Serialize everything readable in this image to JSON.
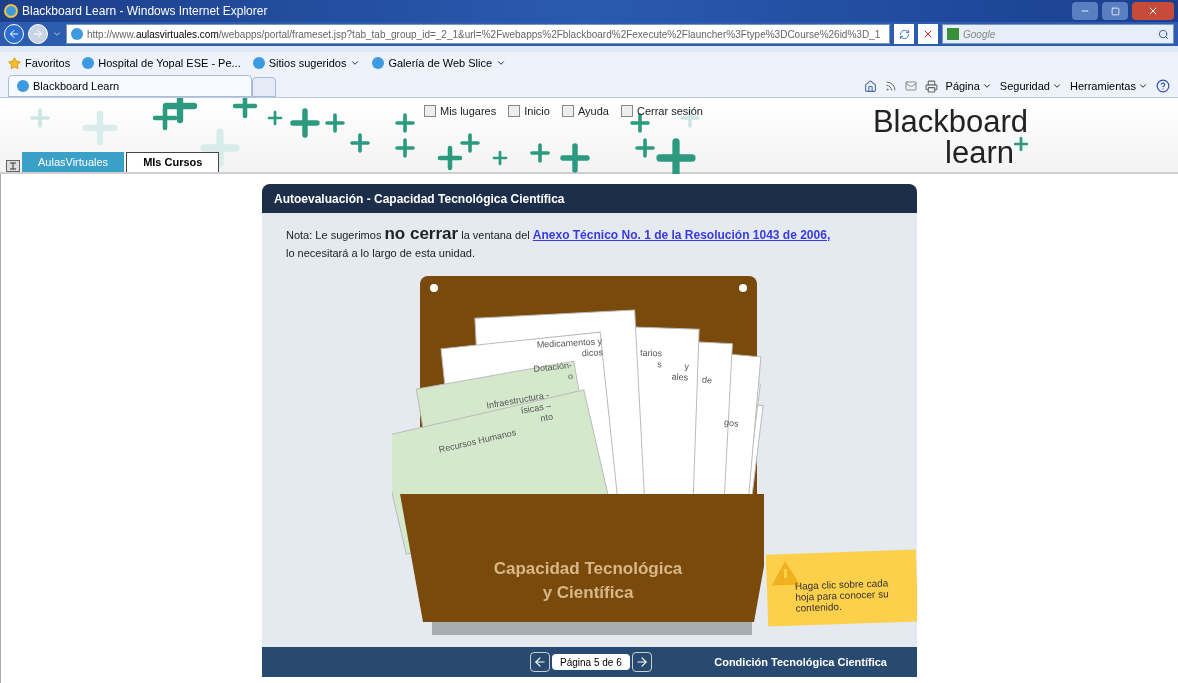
{
  "window": {
    "title": "Blackboard Learn - Windows Internet Explorer"
  },
  "address_bar": {
    "prefix": "http://www.",
    "domain": "aulasvirtuales.com",
    "path": "/webapps/portal/frameset.jsp?tab_tab_group_id=_2_1&url=%2Fwebapps%2Fblackboard%2Fexecute%2Flauncher%3Ftype%3DCourse%26id%3D_1"
  },
  "search": {
    "placeholder": "Google"
  },
  "favorites_bar": {
    "favorites": "Favoritos",
    "links": [
      {
        "label": "Hospital de Yopal ESE - Pe...",
        "menu": false
      },
      {
        "label": "Sitios sugeridos",
        "menu": true
      },
      {
        "label": "Galería de Web Slice",
        "menu": true
      }
    ]
  },
  "browser_tabs": [
    {
      "label": "Blackboard Learn",
      "selected": true
    }
  ],
  "command_bar": [
    "Página",
    "Seguridad",
    "Herramientas"
  ],
  "site_header": {
    "links": [
      "Mis lugares",
      "Inicio",
      "Ayuda",
      "Cerrar sesión"
    ],
    "tabs": [
      {
        "label": "AulasVirtuales",
        "selected": false
      },
      {
        "label": "MIs Cursos",
        "selected": true
      }
    ],
    "logo": {
      "word": "Blackboard",
      "sub": "learn"
    }
  },
  "module": {
    "title": "Autoevaluación - Capacidad Tecnológica Científica",
    "note": {
      "before": "Nota: Le sugerimos",
      "emphasis": "no cerrar",
      "after": "la ventana del",
      "link": "Anexo Técnico No. 1 de la Resolución 1043 de 2006,",
      "line2": "lo necesitará a lo largo de esta unidad."
    },
    "cards": [
      {
        "lines": [
          "gos"
        ],
        "color": "#ffffff"
      },
      {
        "color": "#ffffff"
      },
      {
        "lines": [
          "de"
        ],
        "color": "#ffffff"
      },
      {
        "lines": [
          "y",
          "ales"
        ],
        "color": "#ffffff"
      },
      {
        "lines": [
          "tarios",
          "s"
        ],
        "color": "#ffffff"
      },
      {
        "lines": [
          "Medicamentos y",
          "dicos"
        ],
        "color": "#ffffff"
      },
      {
        "lines": [
          "Dotación-",
          "o"
        ],
        "color": "#ffffff"
      },
      {
        "lines": [
          "Infraestructura -",
          "ísicas –",
          "nto"
        ],
        "color": "#d4e8cc"
      },
      {
        "lines": [
          "Recursos Humanos"
        ],
        "color": "#d4e8cc"
      }
    ],
    "pocket_label": "Capacidad Tecnológica y Científica",
    "tip": "Haga clic sobre cada hoja para conocer su contenido.",
    "pager": "Página 5 de 6",
    "footer_title": "Condición Tecnológica Científica"
  }
}
